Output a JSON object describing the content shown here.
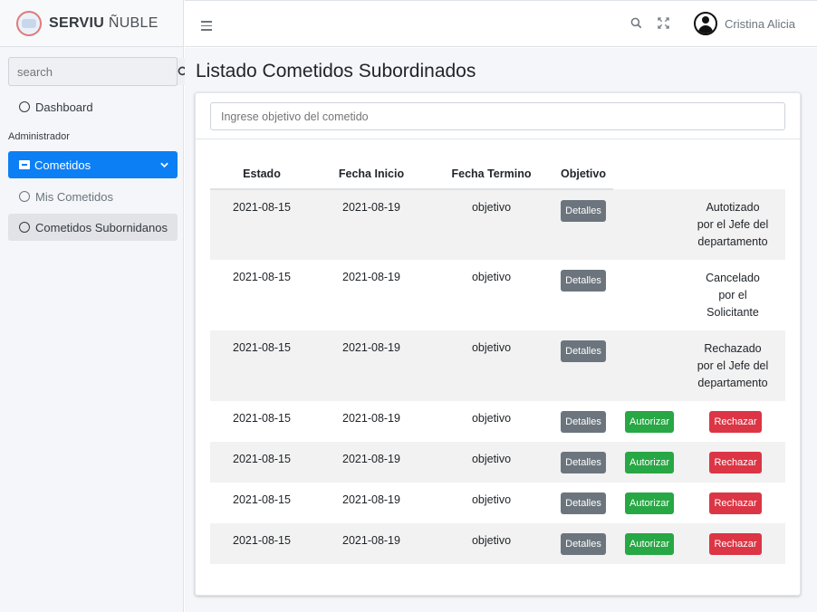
{
  "brand": {
    "name": "SERVIU",
    "suffix": "ÑUBLE"
  },
  "sidebar": {
    "search_placeholder": "search",
    "dashboard": "Dashboard",
    "section_header": "Administrador",
    "cometidos": "Cometidos",
    "mis_cometidos": "Mis Cometidos",
    "cometidos_subordinados": "Cometidos Subornidanos"
  },
  "topbar": {
    "user_name": "Cristina Alicia"
  },
  "page": {
    "title": "Listado Cometidos Subordinados"
  },
  "filter": {
    "placeholder": "Ingrese objetivo del cometido"
  },
  "table": {
    "headers": {
      "estado": "Estado",
      "fecha_inicio": "Fecha Inicio",
      "fecha_termino": "Fecha Termino",
      "objetivo": "Objetivo"
    },
    "rows": [
      {
        "estado": "2021-08-15",
        "fecha_inicio": "2021-08-19",
        "fecha_termino": "objetivo",
        "detalles": "Detalles",
        "status_lines": [
          "Autotizado",
          "por el Jefe del",
          "departamento"
        ]
      },
      {
        "estado": "2021-08-15",
        "fecha_inicio": "2021-08-19",
        "fecha_termino": "objetivo",
        "detalles": "Detalles",
        "status_lines": [
          "Cancelado",
          "por el",
          "Solicitante"
        ]
      },
      {
        "estado": "2021-08-15",
        "fecha_inicio": "2021-08-19",
        "fecha_termino": "objetivo",
        "detalles": "Detalles",
        "status_lines": [
          "Rechazado",
          "por el Jefe del",
          "departamento"
        ]
      },
      {
        "estado": "2021-08-15",
        "fecha_inicio": "2021-08-19",
        "fecha_termino": "objetivo",
        "detalles": "Detalles",
        "autorizar": "Autorizar",
        "rechazar": "Rechazar"
      },
      {
        "estado": "2021-08-15",
        "fecha_inicio": "2021-08-19",
        "fecha_termino": "objetivo",
        "detalles": "Detalles",
        "autorizar": "Autorizar",
        "rechazar": "Rechazar"
      },
      {
        "estado": "2021-08-15",
        "fecha_inicio": "2021-08-19",
        "fecha_termino": "objetivo",
        "detalles": "Detalles",
        "autorizar": "Autorizar",
        "rechazar": "Rechazar"
      },
      {
        "estado": "2021-08-15",
        "fecha_inicio": "2021-08-19",
        "fecha_termino": "objetivo",
        "detalles": "Detalles",
        "autorizar": "Autorizar",
        "rechazar": "Rechazar"
      }
    ]
  },
  "colors": {
    "primary": "#0d7ff5",
    "secondary": "#6c757d",
    "success": "#28a745",
    "danger": "#dc3545"
  },
  "icons": [
    "hamburger-icon",
    "search-icon",
    "expand-icon",
    "user-avatar-icon",
    "circle-icon",
    "archive-icon",
    "chevron-down-icon"
  ]
}
